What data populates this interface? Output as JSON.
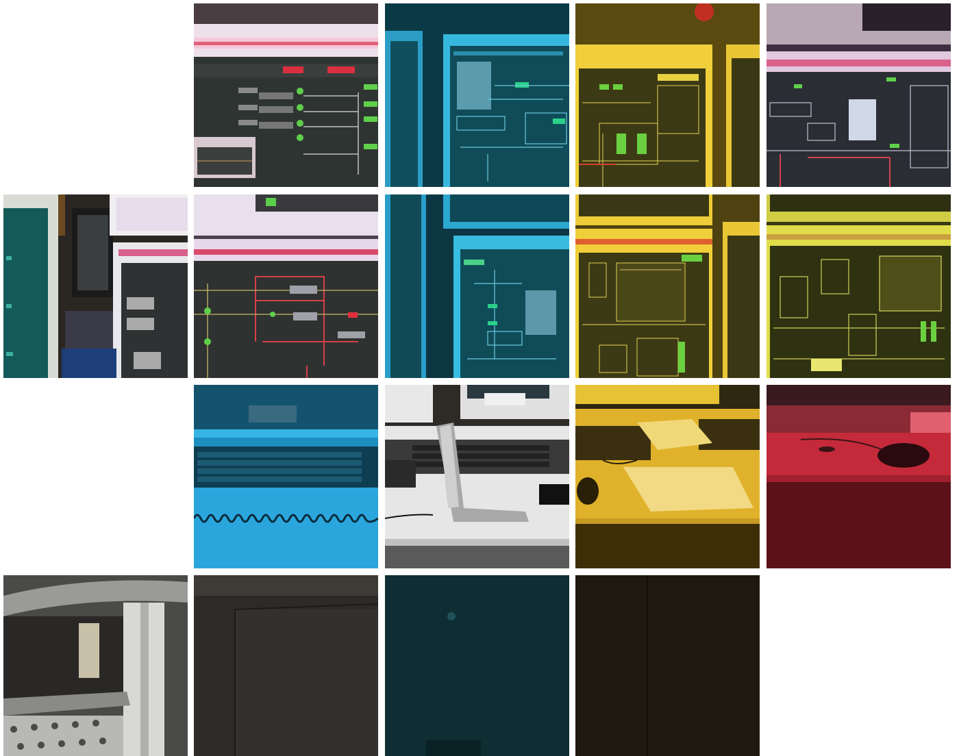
{
  "image": {
    "subject": "control-room-monitors-collage",
    "tiles": [
      {
        "id": "r1c2",
        "tint": "#b05070",
        "content": "monitor-schematic"
      },
      {
        "id": "r1c3",
        "tint": "#1a8fb0",
        "content": "monitor-schematic"
      },
      {
        "id": "r1c4",
        "tint": "#d4a82a",
        "content": "monitor-schematic"
      },
      {
        "id": "r1c5",
        "tint": "#a050a0",
        "content": "monitor-schematic"
      },
      {
        "id": "r2c1",
        "tint": "#1d6a60",
        "content": "monitor-edge"
      },
      {
        "id": "r2c2",
        "tint": "#6a5a80",
        "content": "monitor-schematic"
      },
      {
        "id": "r2c3",
        "tint": "#1a8fb0",
        "content": "monitor-schematic"
      },
      {
        "id": "r2c4",
        "tint": "#d4a82a",
        "content": "monitor-schematic"
      },
      {
        "id": "r2c5",
        "tint": "#c9c93a",
        "content": "monitor-schematic"
      },
      {
        "id": "r3c2",
        "tint": "#1f9ad0",
        "content": "keyboard-desk"
      },
      {
        "id": "r3c3",
        "tint": "#e8e8e8",
        "content": "phone-desk"
      },
      {
        "id": "r3c4",
        "tint": "#e0b12a",
        "content": "mouse-desk"
      },
      {
        "id": "r3c5",
        "tint": "#c42a3a",
        "content": "mouse-desk"
      },
      {
        "id": "r4c1",
        "tint": "#5a5a5a",
        "content": "desk-edge"
      },
      {
        "id": "r4c2",
        "tint": "#2e2a28",
        "content": "cabinet"
      },
      {
        "id": "r4c3",
        "tint": "#0e2e33",
        "content": "cabinet"
      },
      {
        "id": "r4c4",
        "tint": "#1e1810",
        "content": "cabinet"
      }
    ]
  }
}
